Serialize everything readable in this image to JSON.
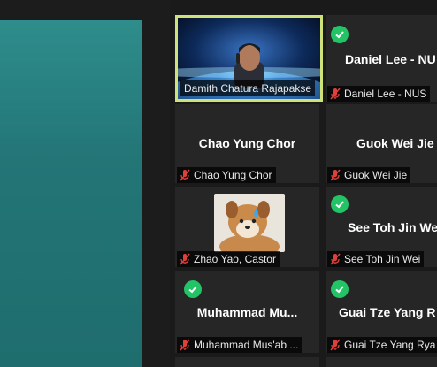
{
  "colors": {
    "share_bg": "#2a7e7f",
    "check": "#23c466",
    "active_border": "#cfe27a",
    "mute": "#e0403a"
  },
  "participants": [
    {
      "display": "",
      "label": "Damith Chatura Rajapakse",
      "status": "video",
      "muted": false,
      "active": true
    },
    {
      "display": "Daniel Lee - NU",
      "label": "Daniel Lee - NUS",
      "status": "check-icon",
      "muted": true
    },
    {
      "display": "Chao Yung Chor",
      "label": "Chao Yung Chor",
      "status": "",
      "muted": true
    },
    {
      "display": "Guok Wei Jie",
      "label": "Guok Wei Jie",
      "status": "",
      "muted": true
    },
    {
      "display": "",
      "label": "Zhao Yao, Castor",
      "status": "avatar-image",
      "muted": true
    },
    {
      "display": "See Toh Jin We",
      "label": "See Toh Jin Wei",
      "status": "check-icon",
      "muted": true
    },
    {
      "display": "Muhammad  Mu...",
      "label": "Muhammad Mus'ab ...",
      "status": "check-icon",
      "muted": true
    },
    {
      "display": "Guai Tze Yang R",
      "label": "Guai Tze Yang Rya",
      "status": "check-icon",
      "muted": true
    }
  ]
}
